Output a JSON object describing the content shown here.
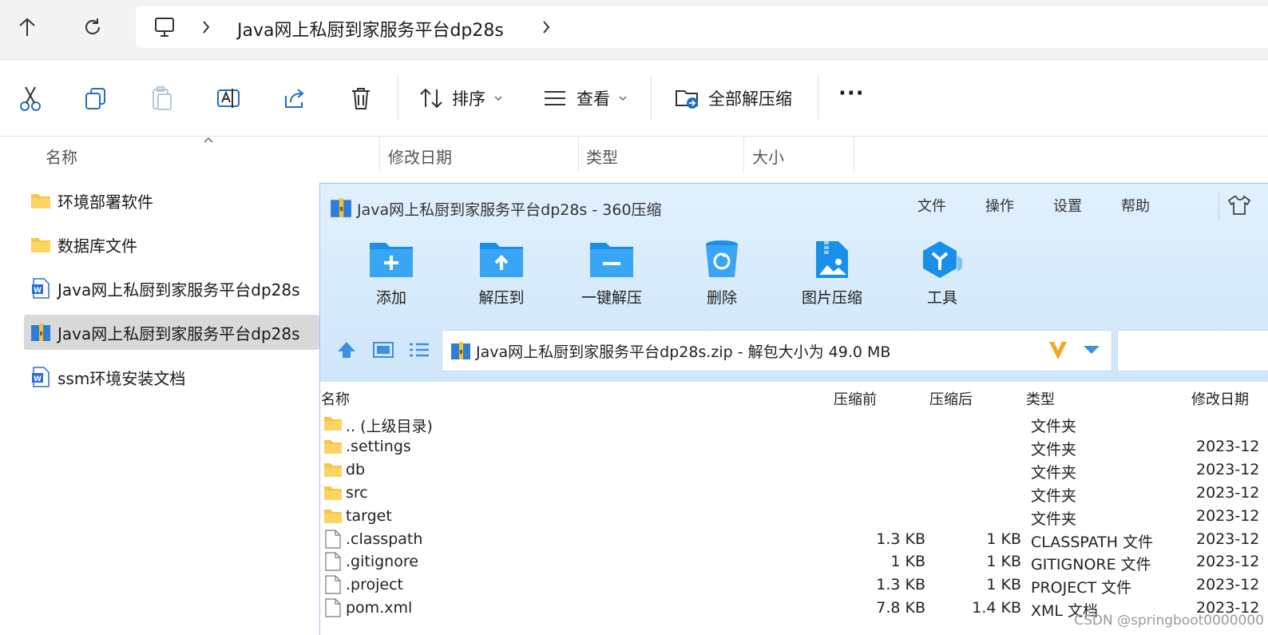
{
  "address": {
    "path": "Java网上私厨到家服务平台dp28s"
  },
  "toolbar": {
    "sort_label": "排序",
    "view_label": "查看",
    "extract_all_label": "全部解压缩",
    "more_label": "···"
  },
  "columns": {
    "name": "名称",
    "modified": "修改日期",
    "type": "类型",
    "size": "大小"
  },
  "explorer_items": [
    {
      "label": "环境部署软件",
      "icon": "folder-icon"
    },
    {
      "label": "数据库文件",
      "icon": "folder-icon"
    },
    {
      "label": "Java网上私厨到家服务平台dp28s",
      "icon": "word-doc-icon"
    },
    {
      "label": "Java网上私厨到家服务平台dp28s",
      "icon": "zip-archive-icon",
      "selected": true
    },
    {
      "label": "ssm环境安装文档",
      "icon": "word-doc-icon"
    }
  ],
  "zip_window": {
    "title": "Java网上私厨到家服务平台dp28s - 360压缩",
    "menu": [
      "文件",
      "操作",
      "设置",
      "帮助"
    ],
    "buttons": [
      "添加",
      "解压到",
      "一键解压",
      "删除",
      "图片压缩",
      "工具"
    ],
    "path_text": "Java网上私厨到家服务平台dp28s.zip - 解包大小为 49.0 MB",
    "list_headers": {
      "name": "名称",
      "before": "压缩前",
      "after": "压缩后",
      "type": "类型",
      "modified": "修改日期"
    },
    "rows": [
      {
        "name": ".. (上级目录)",
        "before": "",
        "after": "",
        "type": "文件夹",
        "modified": "",
        "icon": "folder-icon"
      },
      {
        "name": ".settings",
        "before": "",
        "after": "",
        "type": "文件夹",
        "modified": "2023-12",
        "icon": "folder-icon"
      },
      {
        "name": "db",
        "before": "",
        "after": "",
        "type": "文件夹",
        "modified": "2023-12",
        "icon": "folder-icon"
      },
      {
        "name": "src",
        "before": "",
        "after": "",
        "type": "文件夹",
        "modified": "2023-12",
        "icon": "folder-icon"
      },
      {
        "name": "target",
        "before": "",
        "after": "",
        "type": "文件夹",
        "modified": "2023-12",
        "icon": "folder-icon"
      },
      {
        "name": ".classpath",
        "before": "1.3 KB",
        "after": "1 KB",
        "type": "CLASSPATH 文件",
        "modified": "2023-12",
        "icon": "file-icon"
      },
      {
        "name": ".gitignore",
        "before": "1 KB",
        "after": "1 KB",
        "type": "GITIGNORE 文件",
        "modified": "2023-12",
        "icon": "file-icon"
      },
      {
        "name": ".project",
        "before": "1.3 KB",
        "after": "1 KB",
        "type": "PROJECT 文件",
        "modified": "2023-12",
        "icon": "file-icon"
      },
      {
        "name": "pom.xml",
        "before": "7.8 KB",
        "after": "1.4 KB",
        "type": "XML 文档",
        "modified": "2023-12",
        "icon": "file-icon"
      }
    ]
  },
  "watermark": "CSDN @springboot0000000"
}
